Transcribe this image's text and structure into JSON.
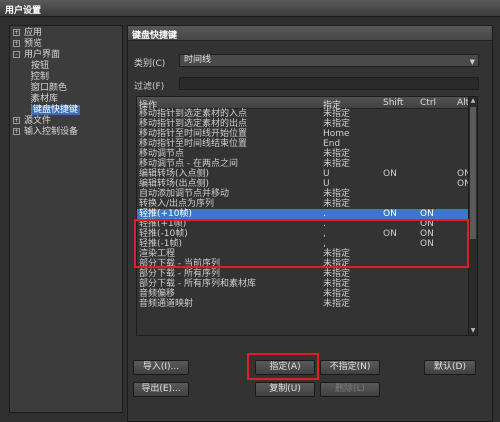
{
  "window": {
    "title": "用户设置"
  },
  "tree": [
    {
      "label": "应用",
      "expander": "+"
    },
    {
      "label": "预览",
      "expander": "+"
    },
    {
      "label": "用户界面",
      "expander": "-"
    },
    {
      "label": "按钮"
    },
    {
      "label": "控制"
    },
    {
      "label": "窗口颜色"
    },
    {
      "label": "素材库"
    },
    {
      "label": "键盘快捷键",
      "selected": true
    },
    {
      "label": "源文件",
      "expander": "+"
    },
    {
      "label": "输入控制设备",
      "expander": "+"
    }
  ],
  "panel": {
    "title": "键盘快捷键",
    "category_label": "类别(C)",
    "category_value": "时间线",
    "filter_label": "过滤(F)"
  },
  "table": {
    "headers": {
      "action": "操作",
      "key": "指定",
      "shift": "Shift",
      "ctrl": "Ctrl",
      "alt": "Alt"
    },
    "rows": [
      {
        "action": "移动指针到选定素材的入点",
        "key": "未指定",
        "shift": "",
        "ctrl": "",
        "alt": ""
      },
      {
        "action": "移动指针到选定素材的出点",
        "key": "未指定",
        "shift": "",
        "ctrl": "",
        "alt": ""
      },
      {
        "action": "移动指针至时间线开始位置",
        "key": "Home",
        "shift": "",
        "ctrl": "",
        "alt": ""
      },
      {
        "action": "移动指针至时间线结束位置",
        "key": "End",
        "shift": "",
        "ctrl": "",
        "alt": ""
      },
      {
        "action": "移动调节点",
        "key": "未指定",
        "shift": "",
        "ctrl": "",
        "alt": ""
      },
      {
        "action": "移动调节点 - 在两点之间",
        "key": "未指定",
        "shift": "",
        "ctrl": "",
        "alt": ""
      },
      {
        "action": "编辑转场(入点侧)",
        "key": "U",
        "shift": "ON",
        "ctrl": "",
        "alt": "ON"
      },
      {
        "action": "编辑转场(出点侧)",
        "key": "U",
        "shift": "",
        "ctrl": "",
        "alt": "ON"
      },
      {
        "action": "自动添加调节点并移动",
        "key": "未指定",
        "shift": "",
        "ctrl": "",
        "alt": ""
      },
      {
        "action": "转换入/出点为序列",
        "key": "未指定",
        "shift": "",
        "ctrl": "",
        "alt": ""
      },
      {
        "action": "轻推(+10帧)",
        "key": ".",
        "shift": "ON",
        "ctrl": "ON",
        "alt": "",
        "selected": true
      },
      {
        "action": "轻推(+1帧)",
        "key": ".",
        "shift": "",
        "ctrl": "ON",
        "alt": ""
      },
      {
        "action": "轻推(-10帧)",
        "key": ",",
        "shift": "ON",
        "ctrl": "ON",
        "alt": ""
      },
      {
        "action": "轻推(-1帧)",
        "key": ",",
        "shift": "",
        "ctrl": "ON",
        "alt": ""
      },
      {
        "action": "渲染工程",
        "key": "未指定",
        "shift": "",
        "ctrl": "",
        "alt": ""
      },
      {
        "action": "部分下载 - 当前序列",
        "key": "未指定",
        "shift": "",
        "ctrl": "",
        "alt": ""
      },
      {
        "action": "部分下载 - 所有序列",
        "key": "未指定",
        "shift": "",
        "ctrl": "",
        "alt": ""
      },
      {
        "action": "部分下载 - 所有序列和素材库",
        "key": "未指定",
        "shift": "",
        "ctrl": "",
        "alt": ""
      },
      {
        "action": "音频偏移",
        "key": "未指定",
        "shift": "",
        "ctrl": "",
        "alt": ""
      },
      {
        "action": "音频通道映射",
        "key": "未指定",
        "shift": "",
        "ctrl": "",
        "alt": ""
      }
    ]
  },
  "buttons": {
    "import": "导入(I)...",
    "export": "导出(E)...",
    "assign": "指定(A)",
    "unassign": "不指定(N)",
    "default": "默认(D)",
    "duplicate": "复制(U)",
    "delete": "删除(L)"
  },
  "colors": {
    "selection": "#3b78c8",
    "highlight_frame": "#e02020"
  }
}
